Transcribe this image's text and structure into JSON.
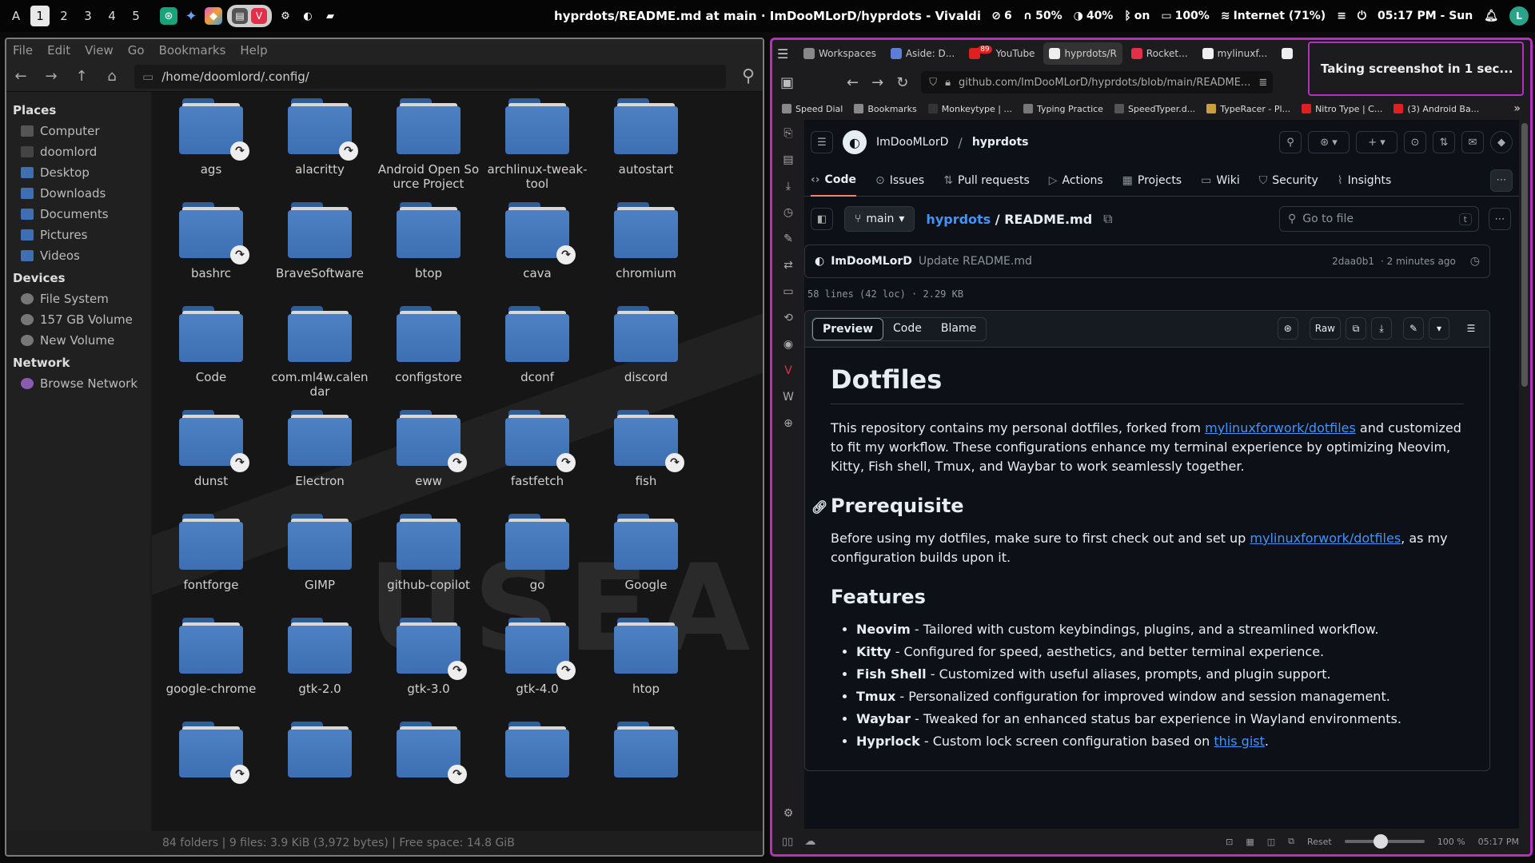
{
  "waybar": {
    "launcher": "A",
    "workspaces": [
      "1",
      "2",
      "3",
      "4",
      "5"
    ],
    "active_workspace": "1",
    "window_title": "hyprdots/README.md at main · ImDooMLorD/hyprdots - Vivaldi",
    "stats": {
      "updates": "6",
      "headphones": "50%",
      "brightness": "40%",
      "bluetooth": "on",
      "battery": "100%",
      "network": "Internet (71%)"
    },
    "clock": "05:17 PM - Sun",
    "avatar": "L"
  },
  "filemanager": {
    "menu": [
      "File",
      "Edit",
      "View",
      "Go",
      "Bookmarks",
      "Help"
    ],
    "path": "/home/doomlord/.config/",
    "sidebar": {
      "places_header": "Places",
      "places": [
        "Computer",
        "doomlord",
        "Desktop",
        "Downloads",
        "Documents",
        "Pictures",
        "Videos"
      ],
      "devices_header": "Devices",
      "devices": [
        "File System",
        "157 GB Volume",
        "New Volume"
      ],
      "network_header": "Network",
      "network": [
        "Browse Network"
      ]
    },
    "folders": [
      {
        "name": "ags",
        "link": true
      },
      {
        "name": "alacritty",
        "link": true
      },
      {
        "name": "Android Open Source Project",
        "link": false
      },
      {
        "name": "archlinux-tweak-tool",
        "link": false
      },
      {
        "name": "autostart",
        "link": false
      },
      {
        "name": "bashrc",
        "link": true
      },
      {
        "name": "BraveSoftware",
        "link": false
      },
      {
        "name": "btop",
        "link": false
      },
      {
        "name": "cava",
        "link": true
      },
      {
        "name": "chromium",
        "link": false
      },
      {
        "name": "Code",
        "link": false
      },
      {
        "name": "com.ml4w.calendar",
        "link": false
      },
      {
        "name": "configstore",
        "link": false
      },
      {
        "name": "dconf",
        "link": false
      },
      {
        "name": "discord",
        "link": false
      },
      {
        "name": "dunst",
        "link": true
      },
      {
        "name": "Electron",
        "link": false
      },
      {
        "name": "eww",
        "link": true
      },
      {
        "name": "fastfetch",
        "link": true
      },
      {
        "name": "fish",
        "link": true
      },
      {
        "name": "fontforge",
        "link": false
      },
      {
        "name": "GIMP",
        "link": false
      },
      {
        "name": "github-copilot",
        "link": false
      },
      {
        "name": "go",
        "link": false
      },
      {
        "name": "Google",
        "link": false
      },
      {
        "name": "google-chrome",
        "link": false
      },
      {
        "name": "gtk-2.0",
        "link": false
      },
      {
        "name": "gtk-3.0",
        "link": true
      },
      {
        "name": "gtk-4.0",
        "link": true
      },
      {
        "name": "htop",
        "link": false
      },
      {
        "name": "",
        "link": true
      },
      {
        "name": "",
        "link": false
      },
      {
        "name": "",
        "link": true
      },
      {
        "name": "",
        "link": false
      },
      {
        "name": "",
        "link": false
      }
    ],
    "status": "84 folders  |  9 files: 3.9 KiB (3,972 bytes)  |  Free space: 14.8 GiB"
  },
  "browser": {
    "tabs": [
      {
        "label": "Workspaces",
        "color": "#888"
      },
      {
        "label": "Aside: D...",
        "color": "#5b7fd6"
      },
      {
        "label": "YouTube",
        "color": "#e02020",
        "badge": "89"
      },
      {
        "label": "hyprdots/R",
        "color": "#eee",
        "active": true
      },
      {
        "label": "Rocket...",
        "color": "#e0304a"
      },
      {
        "label": "mylinuxf...",
        "color": "#eee"
      },
      {
        "label": "",
        "color": "#eee"
      }
    ],
    "url": "github.com/ImDooMLorD/hyprdots/blob/main/README...",
    "bookmarks": [
      "Speed Dial",
      "Bookmarks",
      "Monkeytype | ...",
      "Typing Practice",
      "SpeedTyper.d...",
      "TypeRacer - Pl...",
      "Nitro Type | C...",
      "(3) Android Ba..."
    ],
    "toast": "Taking screenshot in 1 sec...",
    "statusbar": {
      "reset": "Reset",
      "zoom": "100 %",
      "time": "05:17 PM",
      "zoom_level": 0.45
    }
  },
  "github": {
    "owner": "ImDooMLorD",
    "repo": "hyprdots",
    "nav": [
      "Code",
      "Issues",
      "Pull requests",
      "Actions",
      "Projects",
      "Wiki",
      "Security",
      "Insights"
    ],
    "branch": "main",
    "file": "README.md",
    "gofile_placeholder": "Go to file",
    "gofile_key": "t",
    "commit": {
      "author": "ImDooMLorD",
      "message": "Update README.md",
      "hash": "2daa0b1",
      "time": "· 2 minutes ago"
    },
    "lines": "58 lines (42 loc) · 2.29 KB",
    "view_tabs": [
      "Preview",
      "Code",
      "Blame"
    ],
    "raw": "Raw",
    "readme": {
      "h1": "Dotfiles",
      "intro_1": "This repository contains my personal dotfiles, forked from ",
      "intro_link": "mylinuxforwork/dotfiles",
      "intro_2": " and customized to fit my workflow. These configurations enhance my terminal experience by optimizing Neovim, Kitty, Fish shell, Tmux, and Waybar to work seamlessly together.",
      "h2_prereq": "Prerequisite",
      "prereq_1": "Before using my dotfiles, make sure to first check out and set up ",
      "prereq_link": "mylinuxforwork/dotfiles",
      "prereq_2": ", as my configuration builds upon it.",
      "h2_features": "Features",
      "features": [
        {
          "name": "Neovim",
          "desc": " - Tailored with custom keybindings, plugins, and a streamlined workflow."
        },
        {
          "name": "Kitty",
          "desc": " - Configured for speed, aesthetics, and better terminal experience."
        },
        {
          "name": "Fish Shell",
          "desc": " - Customized with useful aliases, prompts, and plugin support."
        },
        {
          "name": "Tmux",
          "desc": " - Personalized configuration for improved window and session management."
        },
        {
          "name": "Waybar",
          "desc": " - Tweaked for an enhanced status bar experience in Wayland environments."
        },
        {
          "name": "Hyprlock",
          "desc": " - Custom lock screen configuration based on "
        }
      ],
      "hyprlock_link": "this gist",
      "hyprlock_end": "."
    }
  }
}
